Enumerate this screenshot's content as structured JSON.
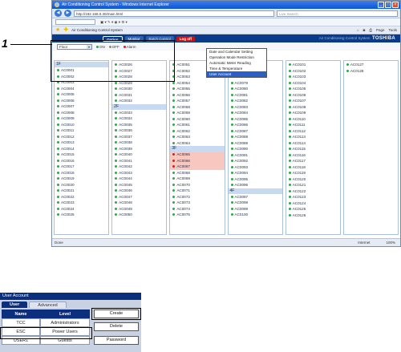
{
  "browser": {
    "window_title": "Air Conditioning Control System - Windows Internet Explorer",
    "address": "http://192.168.0.30/main.html",
    "search_placeholder": "Live Search",
    "tab_title": "Air Conditioning Control System",
    "toolbar_items": [
      "Page",
      "Tools"
    ],
    "status_left": "Done",
    "status_zone": "Internet",
    "status_zoom": "100%"
  },
  "app": {
    "header": {
      "option": "Option",
      "monitor": "Monitor",
      "batch": "Batch Control",
      "logoff": "Log off",
      "title": "Air Conditioning Control System",
      "brand": "TOSHIBA"
    },
    "filter": {
      "floor_value": "Floor",
      "legend": [
        "ON",
        "OFF",
        "Alarm"
      ]
    },
    "option_menu": [
      "Date and Calendar Setting",
      "Operation Mode Restriction",
      "Automatic Meter Reading",
      "Time & Temperature",
      "User Account"
    ],
    "columns": [
      {
        "header": "1F",
        "units": [
          "AC0001",
          "AC0002",
          "AC0003",
          "AC0004",
          "AC0005",
          "AC0006",
          "AC0007",
          "AC0008",
          "AC0009",
          "AC0010",
          "AC0011",
          "AC0012",
          "AC0013",
          "AC0014",
          "AC0015",
          "AC0016",
          "AC0017",
          "AC0018",
          "AC0019",
          "AC0020",
          "AC0021",
          "AC0022",
          "AC0023",
          "AC0024",
          "AC0025"
        ]
      },
      {
        "header": "",
        "units": [
          "AC0026",
          "AC0027",
          "AC0028",
          "AC0029",
          "AC0030",
          "AC0031",
          "AC0032"
        ],
        "header2": "2F",
        "units2": [
          "AC0033",
          "AC0034",
          "AC0035",
          "AC0036",
          "AC0037",
          "AC0038",
          "AC0039",
          "AC0040",
          "AC0041",
          "AC0042",
          "AC0043",
          "AC0044",
          "AC0045",
          "AC0046",
          "AC0047",
          "AC0048",
          "AC0049",
          "AC0050"
        ]
      },
      {
        "units": [
          "AC0051",
          "AC0052",
          "AC0053",
          "AC0054",
          "AC0055",
          "AC0056",
          "AC0057",
          "AC0058",
          "AC0059",
          "AC0060",
          "AC0061",
          "AC0062",
          "AC0063",
          "AC0064"
        ],
        "header2": "3F",
        "units2": [
          "AC0065",
          "AC0066",
          "AC0067",
          "AC0068",
          "AC0069",
          "AC0070",
          "AC0071",
          "AC0072",
          "AC0073",
          "AC0074",
          "AC0075"
        ],
        "alarm_units": [
          "AC0065",
          "AC0066",
          "AC0067"
        ]
      },
      {
        "units": [
          "AC0076",
          "AC0077",
          "AC0078",
          "AC0079",
          "AC0080",
          "AC0081",
          "AC0082",
          "AC0083",
          "AC0084",
          "AC0085",
          "AC0086",
          "AC0087",
          "AC0088",
          "AC0089",
          "AC0090",
          "AC0091",
          "AC0092",
          "AC0093",
          "AC0094",
          "AC0095",
          "AC0096"
        ],
        "header2": "4F",
        "units2": [
          "AC0097",
          "AC0098",
          "AC0099",
          "AC0100"
        ]
      },
      {
        "units": [
          "AC0101",
          "AC0102",
          "AC0103",
          "AC0104",
          "AC0105",
          "AC0106",
          "AC0107",
          "AC0108",
          "AC0109",
          "AC0110",
          "AC0111",
          "AC0112",
          "AC0113",
          "AC0114",
          "AC0115",
          "AC0116",
          "AC0117",
          "AC0118",
          "AC0119",
          "AC0120",
          "AC0121",
          "AC0122",
          "AC0123",
          "AC0124",
          "AC0125",
          "AC0126"
        ]
      },
      {
        "units": [
          "AC0127",
          "AC0128"
        ]
      }
    ]
  },
  "callout": {
    "number": "1"
  },
  "user_account": {
    "title": "User Account",
    "tabs": [
      "User",
      "Advanced"
    ],
    "table_headers": [
      "Name",
      "Level"
    ],
    "rows": [
      {
        "name": "TCC",
        "level": "Administrators"
      },
      {
        "name": "ESC",
        "level": "Power Users"
      },
      {
        "name": "USER1",
        "level": "Guests"
      }
    ],
    "buttons": [
      "Create",
      "Delete",
      "Password"
    ]
  }
}
